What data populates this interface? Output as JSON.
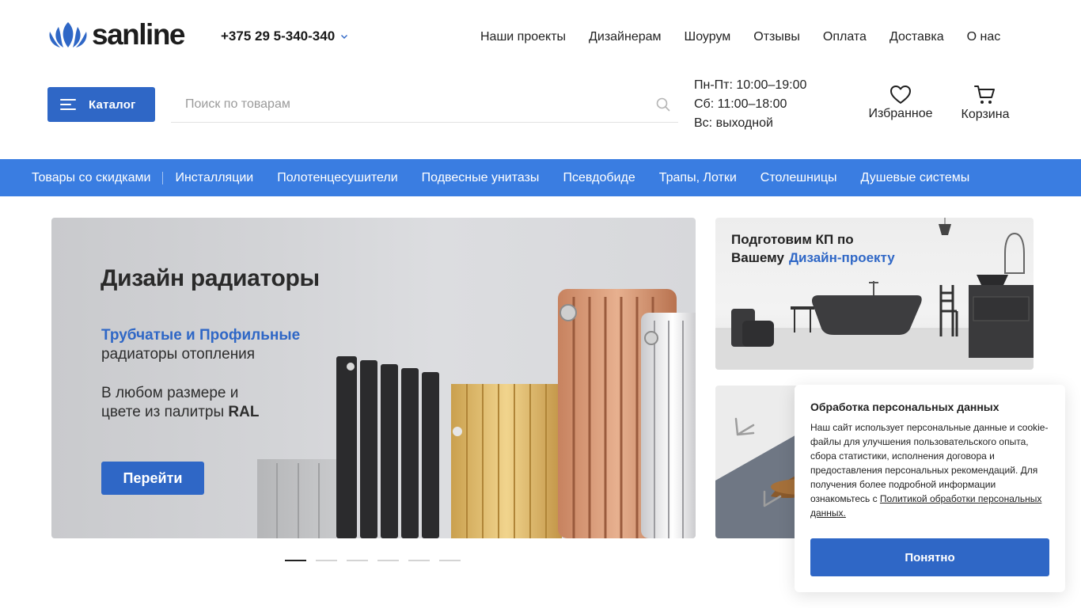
{
  "header": {
    "logo_text": "sanline",
    "phone": "+375 29 5-340-340",
    "nav": [
      "Наши проекты",
      "Дизайнерам",
      "Шоурум",
      "Отзывы",
      "Оплата",
      "Доставка",
      "О нас"
    ],
    "catalog_label": "Каталог",
    "search_placeholder": "Поиск по товарам",
    "hours": [
      "Пн-Пт: 10:00–19:00",
      "Сб: 11:00–18:00",
      "Вс: выходной"
    ],
    "favorites_label": "Избранное",
    "cart_label": "Корзина"
  },
  "categories": [
    "Товары со скидками",
    "Инсталляции",
    "Полотенцесушители",
    "Подвесные унитазы",
    "Псевдобиде",
    "Трапы, Лотки",
    "Столешницы",
    "Душевые системы"
  ],
  "hero": {
    "title": "Дизайн радиаторы",
    "subtitle_blue": "Трубчатые и Профильные",
    "subtitle": "радиаторы отопления",
    "text_line1": "В любом размере и",
    "text_line2_prefix": "цвете из палитры",
    "text_line2_bold": "RAL",
    "button": "Перейти"
  },
  "side_banner": {
    "line1": "Подготовим КП по",
    "line2_prefix": "Вашему",
    "line2_blue": "Дизайн-проекту"
  },
  "slider": {
    "count": 6,
    "active": 0
  },
  "cookie": {
    "title": "Обработка персональных данных",
    "text": "Наш сайт использует персональные данные и cookie-файлы для улучшения пользовательского опыта, сбора статистики, исполнения договора и предоставления персональных рекомендаций. Для получения более подробной информации ознакомьтесь с ",
    "link": "Политикой обработки персональных данных.",
    "button": "Понятно"
  },
  "colors": {
    "accent": "#2f67c6",
    "category_bar": "#3a7de1",
    "logo_blue": "#2f67c6"
  },
  "icons": [
    "logo-lotus-icon",
    "chevron-down-icon",
    "menu-icon",
    "search-icon",
    "heart-icon",
    "cart-icon"
  ]
}
